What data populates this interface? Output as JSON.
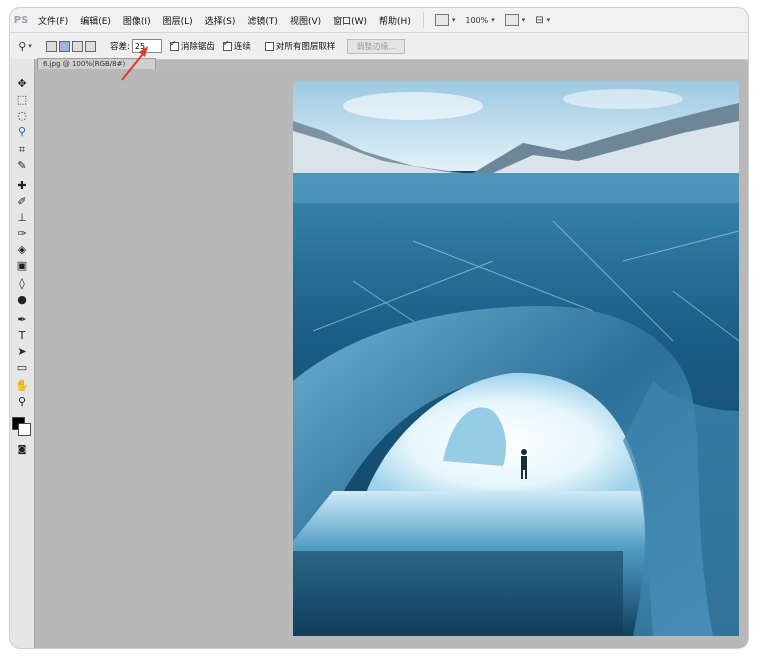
{
  "menubar": {
    "logo": "PS",
    "items": [
      "文件(F)",
      "编辑(E)",
      "图像(I)",
      "图层(L)",
      "选择(S)",
      "滤镜(T)",
      "视图(V)",
      "窗口(W)",
      "帮助(H)"
    ],
    "zoom": "100%"
  },
  "options": {
    "tolerance_label": "容差:",
    "tolerance_value": "25",
    "antialias_label": "消除锯齿",
    "contiguous_label": "连续",
    "sample_all_label": "对所有图层取样",
    "refine_label": "调整边缘..."
  },
  "document": {
    "tab_label": "6.jpg @ 100%(RGB/8#)"
  },
  "colors": {
    "annotation_arrow": "#e03a2f",
    "canvas_bg": "#b8b8b8",
    "ice_dark": "#0f3d58",
    "ice_light": "#bfe6f5"
  },
  "icons": {
    "toolbox": [
      "move-icon",
      "marquee-icon",
      "lasso-icon",
      "magic-wand-icon",
      "crop-icon",
      "eyedropper-icon",
      "healing-icon",
      "brush-icon",
      "stamp-icon",
      "history-brush-icon",
      "eraser-icon",
      "gradient-icon",
      "blur-icon",
      "dodge-icon",
      "pen-icon",
      "type-icon",
      "path-select-icon",
      "shape-icon",
      "hand-icon",
      "zoom-icon"
    ]
  }
}
